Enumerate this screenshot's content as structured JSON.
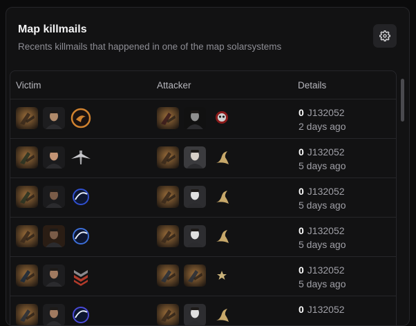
{
  "panel": {
    "title": "Map killmails",
    "subtitle": "Recents killmails that happened in one of the map solarsystems"
  },
  "table": {
    "headers": {
      "victim": "Victim",
      "attacker": "Attacker",
      "details": "Details"
    },
    "rows": [
      {
        "value": "0",
        "system": "J132052",
        "time": "2 days ago",
        "victim": [
          "ship-icon",
          "pilot-portrait-icon",
          "corporation-logo-icon"
        ],
        "attacker": [
          "ship-icon",
          "pilot-portrait-icon",
          "corporation-logo-icon"
        ]
      },
      {
        "value": "0",
        "system": "J132052",
        "time": "5 days ago",
        "victim": [
          "ship-icon",
          "pilot-portrait-icon",
          "corporation-logo-icon"
        ],
        "attacker": [
          "ship-icon",
          "pilot-portrait-icon",
          "corporation-logo-icon"
        ]
      },
      {
        "value": "0",
        "system": "J132052",
        "time": "5 days ago",
        "victim": [
          "ship-icon",
          "pilot-portrait-icon",
          "corporation-logo-icon"
        ],
        "attacker": [
          "ship-icon",
          "pilot-portrait-icon",
          "corporation-logo-icon"
        ]
      },
      {
        "value": "0",
        "system": "J132052",
        "time": "5 days ago",
        "victim": [
          "ship-icon",
          "pilot-portrait-icon",
          "corporation-logo-icon"
        ],
        "attacker": [
          "ship-icon",
          "pilot-portrait-icon",
          "corporation-logo-icon"
        ]
      },
      {
        "value": "0",
        "system": "J132052",
        "time": "5 days ago",
        "victim": [
          "ship-icon",
          "pilot-portrait-icon",
          "corporation-logo-icon"
        ],
        "attacker": [
          "ship-icon",
          "ship-icon",
          "corporation-logo-icon"
        ]
      },
      {
        "value": "0",
        "system": "J132052",
        "time": "",
        "victim": [
          "ship-icon",
          "pilot-portrait-icon",
          "corporation-logo-icon"
        ],
        "attacker": [
          "ship-icon",
          "pilot-portrait-icon",
          "corporation-logo-icon"
        ]
      }
    ]
  },
  "icons": {
    "settings": "gear-icon"
  },
  "colors": {
    "panel_bg": "#121213",
    "border": "#26262a",
    "muted_text": "#8d8d94"
  }
}
